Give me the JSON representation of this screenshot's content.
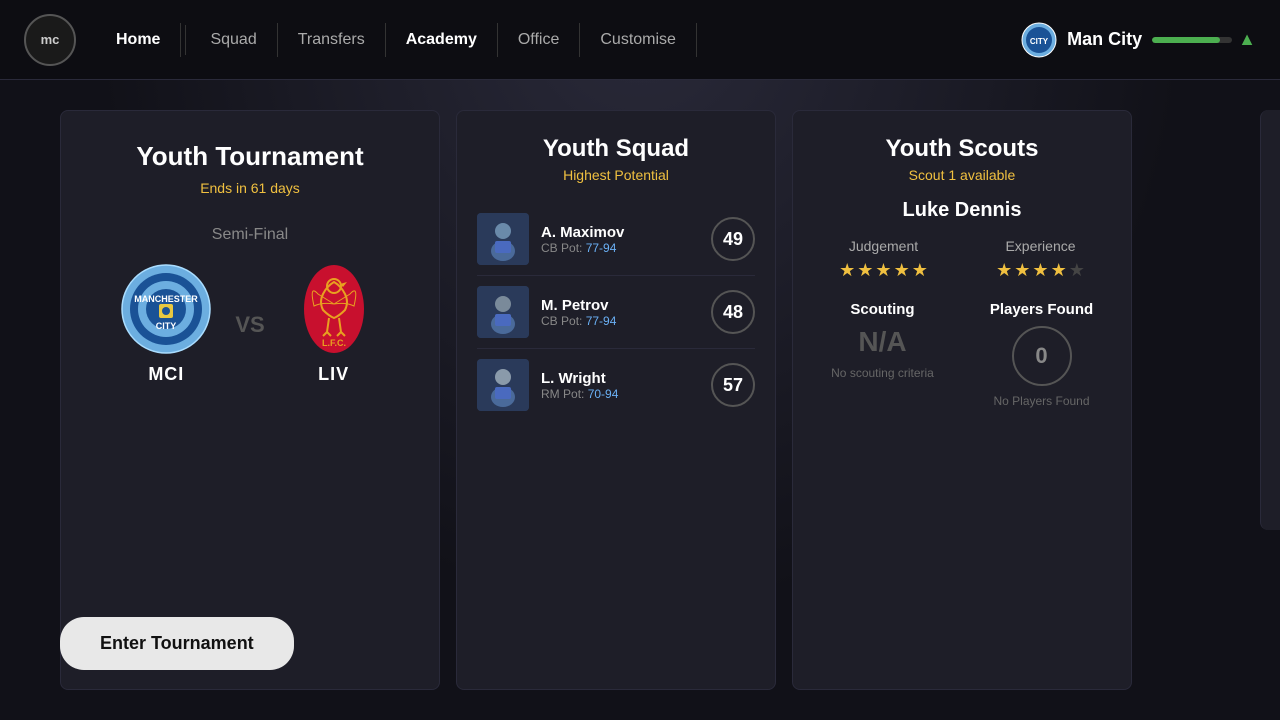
{
  "header": {
    "logo_text": "mc",
    "nav": [
      {
        "label": "Home",
        "active": true,
        "id": "home"
      },
      {
        "label": "Squad",
        "active": false,
        "id": "squad"
      },
      {
        "label": "Transfers",
        "active": false,
        "id": "transfers"
      },
      {
        "label": "Academy",
        "active": true,
        "id": "academy"
      },
      {
        "label": "Office",
        "active": false,
        "id": "office"
      },
      {
        "label": "Customise",
        "active": false,
        "id": "customise"
      }
    ],
    "club_name": "Man City"
  },
  "tournament": {
    "title": "Youth Tournament",
    "ends_label": "Ends in 61 days",
    "stage": "Semi-Final",
    "home_team_code": "MCI",
    "away_team_code": "LIV",
    "vs": "VS"
  },
  "squad": {
    "title": "Youth Squad",
    "subtitle": "Highest Potential",
    "players": [
      {
        "name": "A. Maximov",
        "position": "CB",
        "pot": "77-94",
        "rating": 49
      },
      {
        "name": "M. Petrov",
        "position": "CB",
        "pot": "77-94",
        "rating": 48
      },
      {
        "name": "L. Wright",
        "position": "RM",
        "pot": "70-94",
        "rating": 57
      }
    ]
  },
  "scouts": {
    "title": "Youth Scouts",
    "available_label": "Scout 1 available",
    "scout_name": "Luke Dennis",
    "judgement_label": "Judgement",
    "judgement_stars": 5,
    "experience_label": "Experience",
    "experience_stars": 4,
    "scouting_label": "Scouting",
    "scouting_value": "N/A",
    "scouting_sublabel": "No scouting criteria",
    "players_found_label": "Players Found",
    "players_found_value": "0",
    "players_found_sublabel": "No Players Found"
  },
  "enter_btn_label": "Enter Tournament"
}
